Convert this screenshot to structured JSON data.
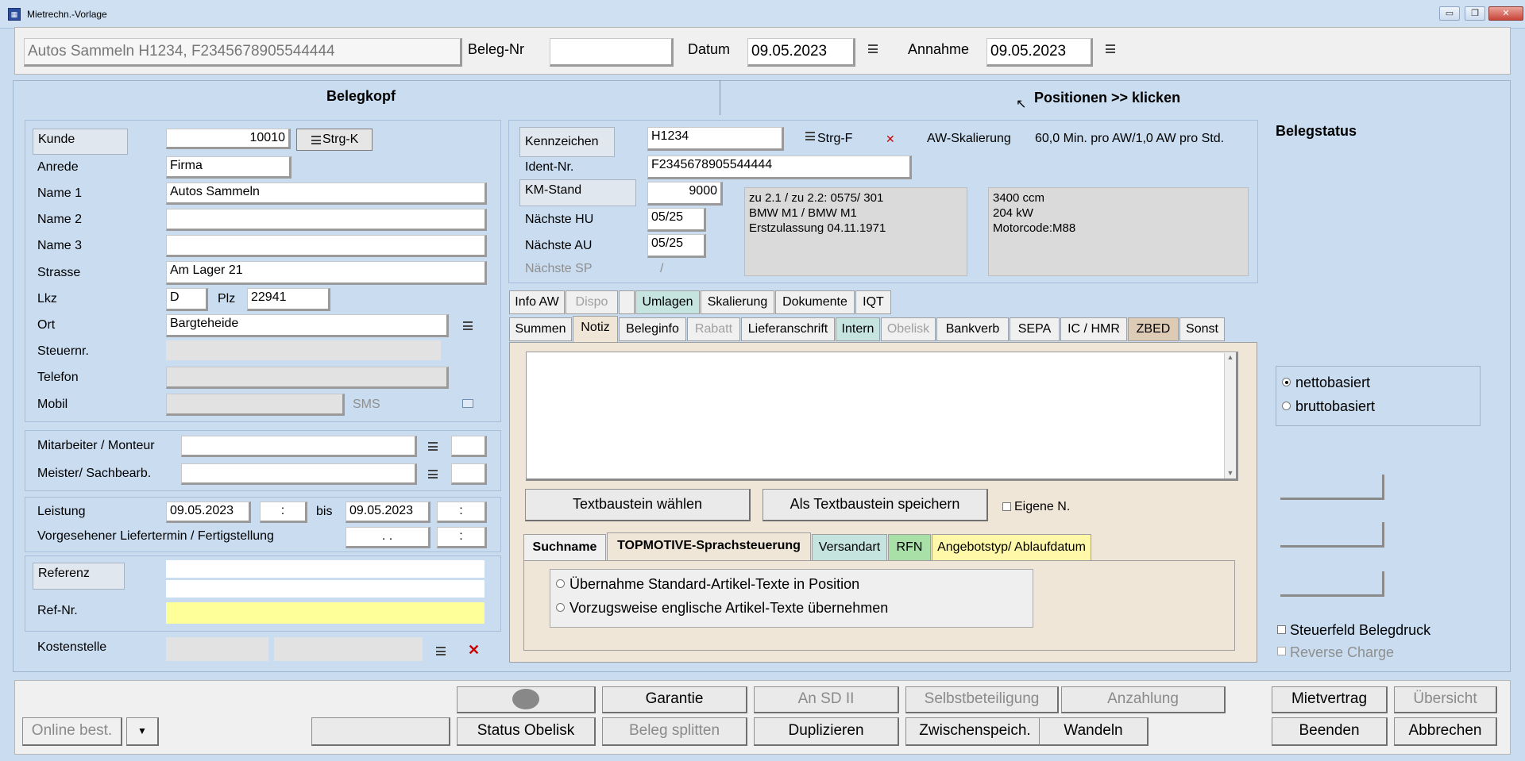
{
  "window": {
    "title": "Mietrechn.-Vorlage",
    "icon": "app-icon"
  },
  "top": {
    "customer_summary": "Autos Sammeln H1234, F2345678905544444",
    "beleg_nr_label": "Beleg-Nr",
    "beleg_nr": "",
    "datum_label": "Datum",
    "datum": "09.05.2023",
    "annahme_label": "Annahme",
    "annahme": "09.05.2023"
  },
  "tabs": {
    "belegkopf": "Belegkopf",
    "positionen": "Positionen >> klicken"
  },
  "customer": {
    "kunde_label": "Kunde",
    "kunde": "10010",
    "strg_k": "Strg-K",
    "anrede_label": "Anrede",
    "anrede": "Firma",
    "name1_label": "Name 1",
    "name1": "Autos Sammeln",
    "name2_label": "Name 2",
    "name2": "",
    "name3_label": "Name 3",
    "name3": "",
    "strasse_label": "Strasse",
    "strasse": "Am Lager 21",
    "lkz_label": "Lkz",
    "lkz": "D",
    "plz_label": "Plz",
    "plz": "22941",
    "ort_label": "Ort",
    "ort": "Bargteheide",
    "steuernr_label": "Steuernr.",
    "telefon_label": "Telefon",
    "mobil_label": "Mobil",
    "sms_label": "SMS"
  },
  "staff": {
    "mitarbeiter_label": "Mitarbeiter / Monteur",
    "meister_label": "Meister/ Sachbearb."
  },
  "leistung": {
    "label": "Leistung",
    "von": "09.05.2023",
    "time1": ":",
    "bis_label": "bis",
    "bis": "09.05.2023",
    "time2": ":",
    "liefertermin_label": "Vorgesehener Liefertermin / Fertigstellung",
    "liefer_date": ". .",
    "time3": ":"
  },
  "referenz": {
    "referenz_label": "Referenz",
    "refnr_label": "Ref-Nr.",
    "kostenstelle_label": "Kostenstelle"
  },
  "vehicle": {
    "kennzeichen_label": "Kennzeichen",
    "kennzeichen": "H1234",
    "strg_f": "Strg-F",
    "aw_label": "AW-Skalierung",
    "aw_value": "60,0 Min. pro AW/1,0 AW pro Std.",
    "ident_label": "Ident-Nr.",
    "ident": "F2345678905544444",
    "km_label": "KM-Stand",
    "km": "9000",
    "hu_label": "Nächste HU",
    "hu": "05/25",
    "au_label": "Nächste AU",
    "au": "05/25",
    "sp_label": "Nächste SP",
    "sp": "/",
    "info1": [
      "zu 2.1 / zu 2.2: 0575/ 301",
      "BMW M1 / BMW M1",
      "Erstzulassung 04.11.1971"
    ],
    "info2": [
      "3400 ccm",
      "204 kW",
      "Motorcode:M88"
    ]
  },
  "tabrow1": [
    "Info AW",
    "Dispo",
    "",
    "Umlagen",
    "Skalierung",
    "Dokumente",
    "IQT"
  ],
  "tabrow2": [
    "Summen",
    "Notiz",
    "Beleginfo",
    "Rabatt",
    "Lieferanschrift",
    "Intern",
    "Obelisk",
    "Bankverb",
    "SEPA",
    "IC / HMR",
    "ZBED",
    "Sonst"
  ],
  "notiz": {
    "text": "",
    "btn_waehlen": "Textbaustein wählen",
    "btn_speichern": "Als Textbaustein speichern",
    "eigene": "Eigene N."
  },
  "subtabs": [
    "Suchname",
    "TOPMOTIVE-Sprachsteuerung",
    "Versandart",
    "RFN",
    "Angebotstyp/ Ablaufdatum"
  ],
  "sprache": {
    "opt1": "Übernahme Standard-Artikel-Texte in Position",
    "opt2": "Vorzugsweise englische Artikel-Texte übernehmen"
  },
  "status": {
    "title": "Belegstatus",
    "netto": "nettobasiert",
    "brutto": "bruttobasiert",
    "steuerfeld": "Steuerfeld Belegdruck",
    "reverse": "Reverse Charge"
  },
  "bottom": {
    "online": "Online best.",
    "garantie": "Garantie",
    "an_sd": "An SD II",
    "selbst": "Selbstbeteiligung",
    "anzahlung": "Anzahlung",
    "mietvertrag": "Mietvertrag",
    "uebersicht": "Übersicht",
    "status_obelisk": "Status Obelisk",
    "splitten": "Beleg splitten",
    "duplizieren": "Duplizieren",
    "zwischen": "Zwischenspeich.",
    "wandeln": "Wandeln",
    "beenden": "Beenden",
    "abbrechen": "Abbrechen"
  }
}
